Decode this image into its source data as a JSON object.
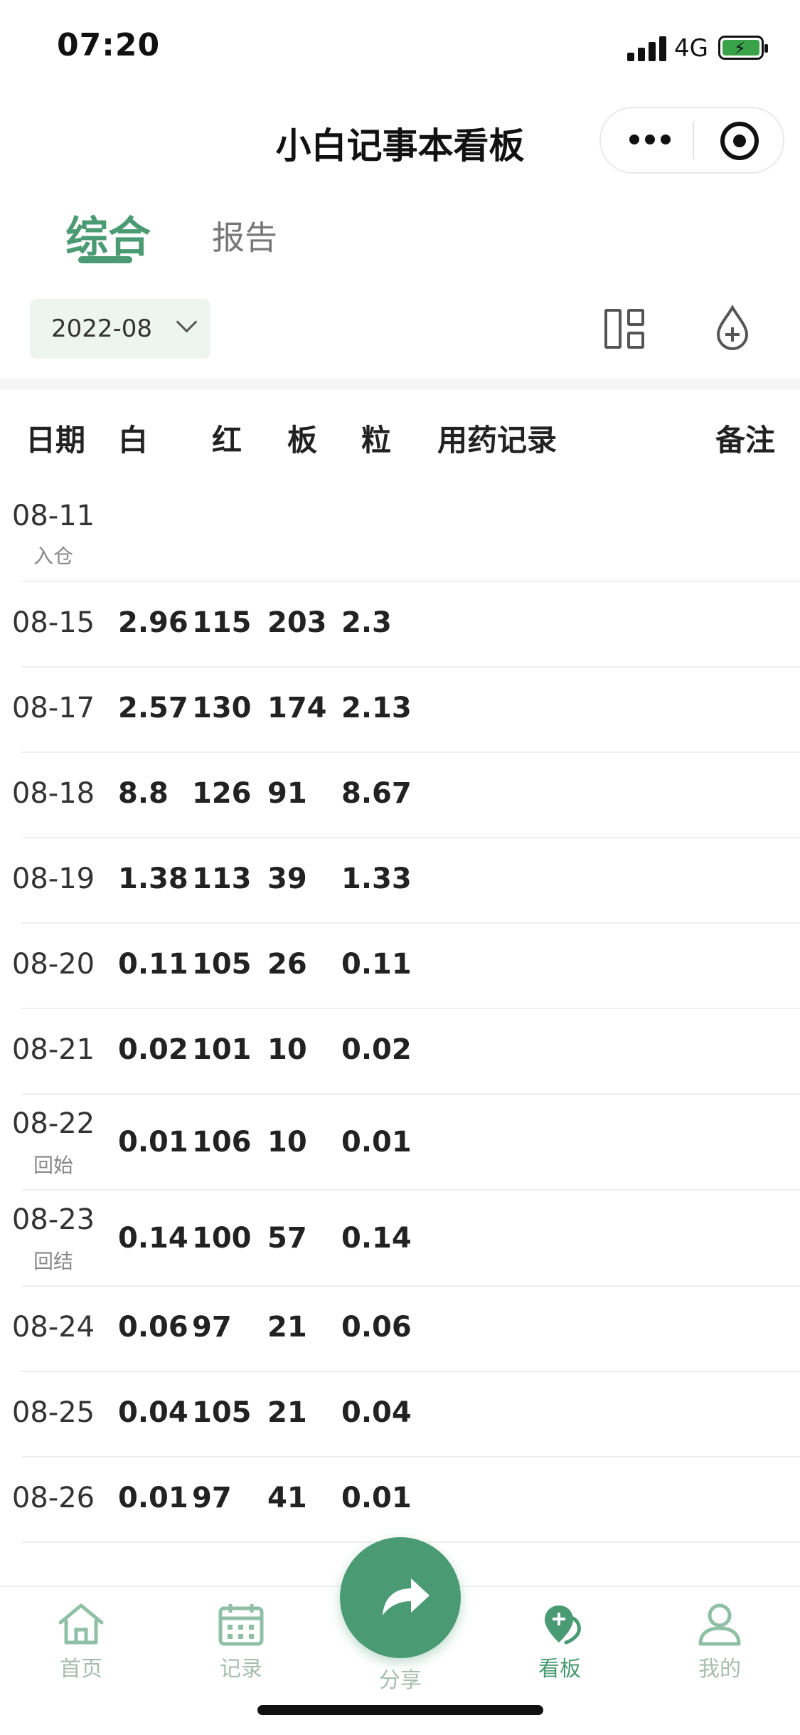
{
  "status_bar": {
    "time": "07:20",
    "network": "4G"
  },
  "nav": {
    "title": "小白记事本看板"
  },
  "tabs": [
    {
      "label": "综合",
      "active": true
    },
    {
      "label": "报告",
      "active": false
    }
  ],
  "filter": {
    "month": "2022-08"
  },
  "table": {
    "headers": {
      "date": "日期",
      "wbc": "白",
      "hb": "红",
      "plt": "板",
      "neut": "粒",
      "meds": "用药记录",
      "notes": "备注"
    },
    "rows": [
      {
        "date": "08-11",
        "sub": "入仓",
        "wbc": "",
        "hb": "",
        "plt": "",
        "neut": ""
      },
      {
        "date": "08-15",
        "sub": "",
        "wbc": "2.96",
        "hb": "115",
        "plt": "203",
        "neut": "2.3"
      },
      {
        "date": "08-17",
        "sub": "",
        "wbc": "2.57",
        "hb": "130",
        "plt": "174",
        "neut": "2.13"
      },
      {
        "date": "08-18",
        "sub": "",
        "wbc": "8.8",
        "hb": "126",
        "plt": "91",
        "neut": "8.67"
      },
      {
        "date": "08-19",
        "sub": "",
        "wbc": "1.38",
        "hb": "113",
        "plt": "39",
        "neut": "1.33"
      },
      {
        "date": "08-20",
        "sub": "",
        "wbc": "0.11",
        "hb": "105",
        "plt": "26",
        "neut": "0.11"
      },
      {
        "date": "08-21",
        "sub": "",
        "wbc": "0.02",
        "hb": "101",
        "plt": "10",
        "neut": "0.02"
      },
      {
        "date": "08-22",
        "sub": "回始",
        "wbc": "0.01",
        "hb": "106",
        "plt": "10",
        "neut": "0.01"
      },
      {
        "date": "08-23",
        "sub": "回结",
        "wbc": "0.14",
        "hb": "100",
        "plt": "57",
        "neut": "0.14"
      },
      {
        "date": "08-24",
        "sub": "",
        "wbc": "0.06",
        "hb": "97",
        "plt": "21",
        "neut": "0.06"
      },
      {
        "date": "08-25",
        "sub": "",
        "wbc": "0.04",
        "hb": "105",
        "plt": "21",
        "neut": "0.04"
      },
      {
        "date": "08-26",
        "sub": "",
        "wbc": "0.01",
        "hb": "97",
        "plt": "41",
        "neut": "0.01"
      }
    ]
  },
  "tabbar": {
    "items": [
      {
        "label": "首页",
        "icon": "home-icon",
        "active": false
      },
      {
        "label": "记录",
        "icon": "calendar-icon",
        "active": false
      },
      {
        "label": "分享",
        "icon": "share-icon",
        "active": false
      },
      {
        "label": "看板",
        "icon": "board-icon",
        "active": true
      },
      {
        "label": "我的",
        "icon": "user-icon",
        "active": false
      }
    ]
  },
  "colors": {
    "accent": "#4a9a73",
    "inactive": "#a8bdb2",
    "tint": "#eef5f1"
  }
}
